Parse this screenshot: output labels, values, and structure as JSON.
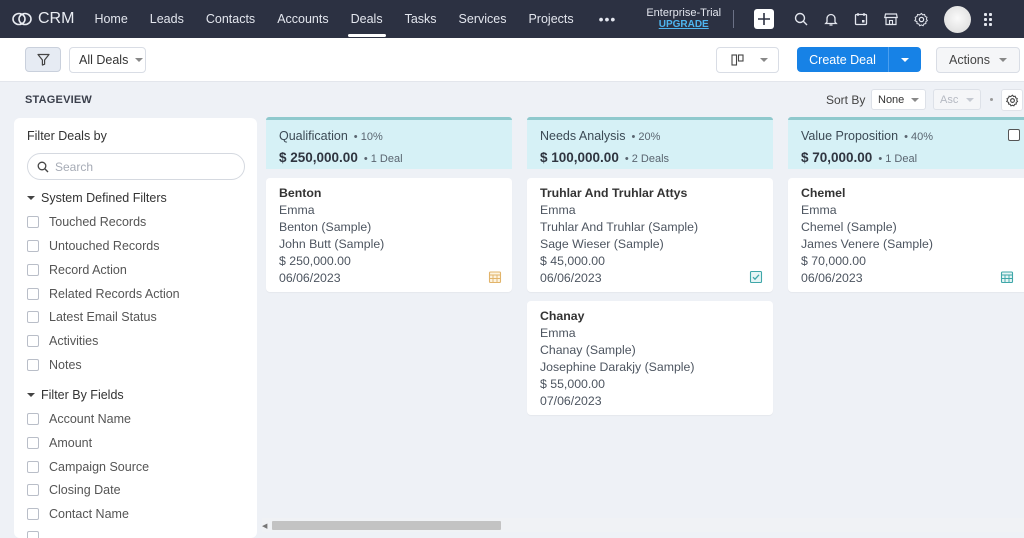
{
  "nav": {
    "app_name": "CRM",
    "items": [
      {
        "label": "Home",
        "active": false
      },
      {
        "label": "Leads",
        "active": false
      },
      {
        "label": "Contacts",
        "active": false
      },
      {
        "label": "Accounts",
        "active": false
      },
      {
        "label": "Deals",
        "active": true
      },
      {
        "label": "Tasks",
        "active": false
      },
      {
        "label": "Services",
        "active": false
      },
      {
        "label": "Projects",
        "active": false
      }
    ],
    "more_label": "•••",
    "trial_label": "Enterprise-Trial",
    "upgrade_label": "UPGRADE",
    "icons": [
      "plus-icon",
      "search-icon",
      "bell-icon",
      "calendar-icon",
      "store-icon",
      "gear-icon",
      "avatar",
      "apps-grid-icon"
    ]
  },
  "toolbar": {
    "filter_icon": "filter-icon",
    "view_select_label": "All Deals",
    "view_mode_icon": "kanban-icon",
    "create_label": "Create Deal",
    "actions_label": "Actions"
  },
  "stageview": {
    "title": "STAGEVIEW",
    "sort_by_label": "Sort By",
    "sort_by_value": "None",
    "sort_order_value": "Asc"
  },
  "filter_panel": {
    "title": "Filter Deals by",
    "search_placeholder": "Search",
    "system_section_label": "System Defined Filters",
    "system_filters": [
      "Touched Records",
      "Untouched Records",
      "Record Action",
      "Related Records Action",
      "Latest Email Status",
      "Activities",
      "Notes"
    ],
    "fields_section_label": "Filter By Fields",
    "field_filters": [
      "Account Name",
      "Amount",
      "Campaign Source",
      "Closing Date",
      "Contact Name"
    ]
  },
  "columns": [
    {
      "name": "Qualification",
      "percent": "• 10%",
      "amount": "$ 250,000.00",
      "count": "• 1 Deal",
      "cards": [
        {
          "title": "Benton",
          "owner": "Emma",
          "account": "Benton (Sample)",
          "contact": "John Butt (Sample)",
          "amount": "$ 250,000.00",
          "date": "06/06/2023",
          "icon": "calendar-icon",
          "icon_color": "#e2b46a"
        }
      ]
    },
    {
      "name": "Needs Analysis",
      "percent": "• 20%",
      "amount": "$ 100,000.00",
      "count": "• 2 Deals",
      "cards": [
        {
          "title": "Truhlar And Truhlar Attys",
          "owner": "Emma",
          "account": "Truhlar And Truhlar (Sample)",
          "contact": "Sage Wieser (Sample)",
          "amount": "$ 45,000.00",
          "date": "06/06/2023",
          "icon": "task-check-icon",
          "icon_color": "#3fa7a9"
        },
        {
          "title": "Chanay",
          "owner": "Emma",
          "account": "Chanay (Sample)",
          "contact": "Josephine Darakjy (Sample)",
          "amount": "$ 55,000.00",
          "date": "07/06/2023",
          "icon": "",
          "icon_color": ""
        }
      ]
    },
    {
      "name": "Value Proposition",
      "percent": "• 40%",
      "amount": "$ 70,000.00",
      "count": "• 1 Deal",
      "cards": [
        {
          "title": "Chemel",
          "owner": "Emma",
          "account": "Chemel (Sample)",
          "contact": "James Venere (Sample)",
          "amount": "$ 70,000.00",
          "date": "06/06/2023",
          "icon": "calendar-icon",
          "icon_color": "#3fa7a9"
        }
      ]
    }
  ]
}
